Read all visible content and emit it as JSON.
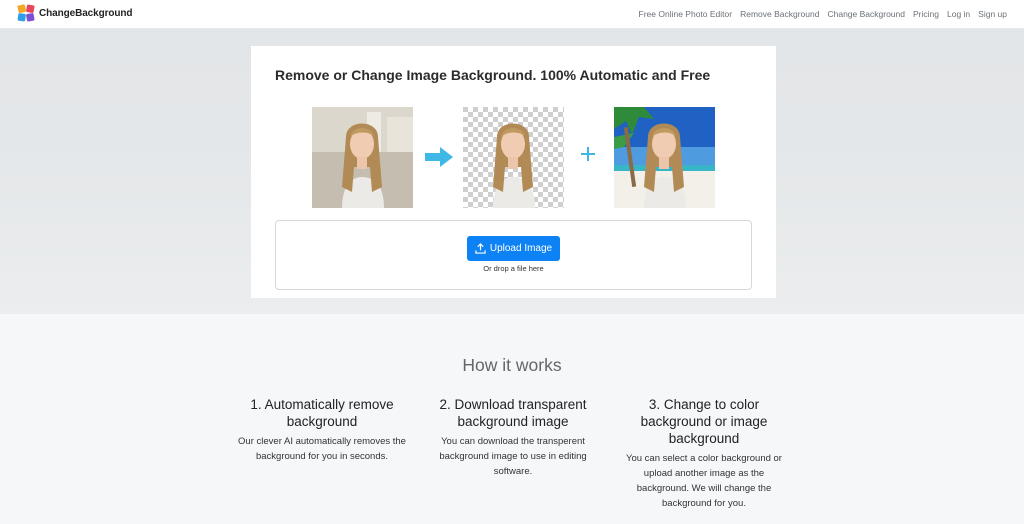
{
  "brand": {
    "name": "ChangeBackground"
  },
  "nav": {
    "links": [
      "Free Online Photo Editor",
      "Remove Background",
      "Change Background",
      "Pricing",
      "Log in",
      "Sign up"
    ]
  },
  "hero": {
    "title": "Remove or Change Image Background. 100% Automatic and Free",
    "upload_label": "Upload Image",
    "drop_text": "Or drop a file here"
  },
  "how": {
    "title": "How it works",
    "steps": [
      {
        "title": "1. Automatically remove background",
        "desc": "Our clever AI automatically removes the background for you in seconds."
      },
      {
        "title": "2. Download transparent background image",
        "desc": "You can download the transperent background image to use in editing software."
      },
      {
        "title": "3. Change to color background or image background",
        "desc": "You can select a color background or upload another image as the background. We will change the background for you."
      }
    ]
  },
  "colors": {
    "accent": "#0d82f5",
    "arrow": "#3fb8e8"
  }
}
